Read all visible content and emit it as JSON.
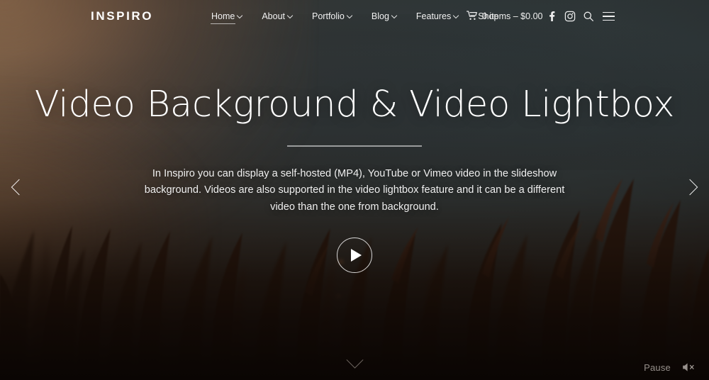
{
  "site": {
    "logo_text": "INSPIRO"
  },
  "nav": {
    "items": [
      {
        "label": "Home",
        "has_dropdown": true,
        "active": true,
        "name": "nav-item-home"
      },
      {
        "label": "About",
        "has_dropdown": true,
        "active": false,
        "name": "nav-item-about"
      },
      {
        "label": "Portfolio",
        "has_dropdown": true,
        "active": false,
        "name": "nav-item-portfolio"
      },
      {
        "label": "Blog",
        "has_dropdown": true,
        "active": false,
        "name": "nav-item-blog"
      },
      {
        "label": "Features",
        "has_dropdown": true,
        "active": false,
        "name": "nav-item-features"
      },
      {
        "label": "Shop",
        "has_dropdown": false,
        "active": false,
        "name": "nav-item-shop"
      }
    ]
  },
  "cart": {
    "label": "0 items – $0.00",
    "item_count": 0,
    "total": "$0.00",
    "icon": "shopping-cart-icon"
  },
  "header_icons": [
    {
      "name": "facebook-icon",
      "label": "Facebook"
    },
    {
      "name": "instagram-icon",
      "label": "Instagram"
    },
    {
      "name": "search-icon",
      "label": "Search"
    },
    {
      "name": "hamburger-menu-icon",
      "label": "Menu"
    }
  ],
  "hero": {
    "heading": "Video Background & Video Lightbox",
    "paragraph": "In Inspiro you can display a self-hosted (MP4), YouTube or Vimeo video in the slideshow background. Videos are also supported in the video lightbox feature and it can be a different video than the one from background.",
    "play_button": "play-button"
  },
  "slider": {
    "prev_label": "Previous slide",
    "next_label": "Next slide"
  },
  "scroll_hint": {
    "label": "Scroll down",
    "icon": "chevron-down-icon"
  },
  "media_controls": {
    "pause_label": "Pause",
    "mute_icon": "speaker-muted-icon"
  },
  "colors": {
    "text": "#ffffff",
    "sky_warm": "#60503f",
    "sky_cool": "#2a3133",
    "foreground": "#0a0503",
    "grass": "#2a1a12",
    "accent_line": "rgba(222,222,222,0.62)"
  }
}
